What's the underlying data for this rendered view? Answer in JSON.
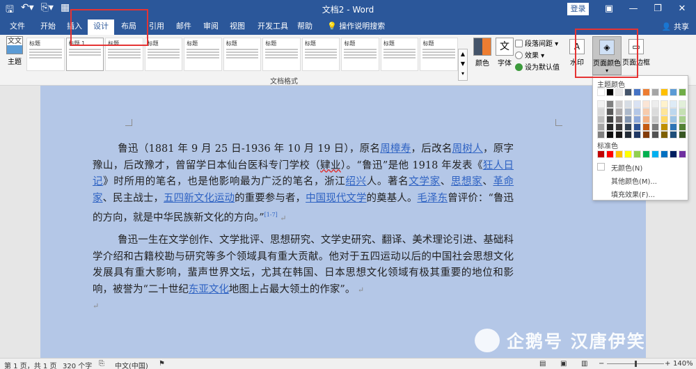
{
  "window": {
    "title": "文档2 - Word",
    "login_label": "登录",
    "share_label": "共享",
    "qat_icons": [
      "save-icon",
      "undo-icon",
      "redo-icon",
      "print-preview-icon"
    ]
  },
  "tabs": [
    {
      "label": "文件"
    },
    {
      "label": "开始"
    },
    {
      "label": "插入"
    },
    {
      "label": "设计"
    },
    {
      "label": "布局"
    },
    {
      "label": "引用"
    },
    {
      "label": "邮件"
    },
    {
      "label": "审阅"
    },
    {
      "label": "视图"
    },
    {
      "label": "开发工具"
    },
    {
      "label": "帮助"
    },
    {
      "label": "操作说明搜索"
    }
  ],
  "active_tab": "设计",
  "ribbon": {
    "theme_label": "主题",
    "theme_icon_text": "文文",
    "gallery_selected_label": "标题 1",
    "gallery_heading": "标题",
    "gallery_group_label": "文档格式",
    "colors_label": "颜色",
    "fonts_label": "字体",
    "fonts_icon_text": "文",
    "paragraph_spacing_label": "段落间距",
    "effects_label": "效果",
    "set_default_label": "设为默认值",
    "watermark_label": "水印",
    "page_color_label": "页面颜色",
    "page_border_label": "页面边框"
  },
  "document": {
    "para1": {
      "t1": "鲁迅（1881 年 9 月 25 日-1936 年 10 月 19 日），原名",
      "l1": "周樟寿",
      "t2": "，后改名",
      "l2": "周树人",
      "t3": "，原字豫山，后改豫才，曾留学日本仙台医科专门学校（",
      "u1": "肄业",
      "t4": "）。“鲁迅”是他 1918 年发表《",
      "l3": "狂人日记",
      "t5": "》时所用的笔名，也是他影响最为广泛的笔名，浙江",
      "l4": "绍兴",
      "t6": "人。著名",
      "l5": "文学家",
      "t7": "、",
      "l6": "思想家",
      "t8": "、",
      "l7": "革命家",
      "t9": "、民主战士，",
      "l8": "五四新文化运动",
      "t10": "的重要参与者，",
      "l9": "中国现代文学",
      "t11": "的奠基人。",
      "l10": "毛泽东",
      "t12": "曾评价：“鲁迅的方向，就是中华民族新文化的方向。”",
      "ref": "[1-7]"
    },
    "para2": {
      "t1": "鲁迅一生在文学创作、文学批评、思想研究、文学史研究、翻译、美术理论引进、基础科学介绍和古籍校勘与研究等多个领域具有重大贡献。他对于五四运动以后的中国社会思想文化发展具有重大影响，蜚声世界文坛，尤其在韩国、日本思想文化领域有极其重要的地位和影响，被誉为“二十世纪",
      "l1": "东亚文化",
      "t2": "地图上占最大领土的作家”。"
    },
    "page_background_color": "#b4c7e7"
  },
  "page_color_menu": {
    "theme_colors_label": "主题颜色",
    "standard_colors_label": "标准色",
    "no_color_label": "无颜色(N)",
    "more_colors_label": "其他颜色(M)...",
    "fill_effects_label": "填充效果(F)...",
    "theme_top_row": [
      "#ffffff",
      "#000000",
      "#e7e6e6",
      "#44546a",
      "#4472c4",
      "#ed7d31",
      "#a5a5a5",
      "#ffc000",
      "#5b9bd5",
      "#70ad47"
    ],
    "theme_shades": [
      [
        "#f2f2f2",
        "#808080",
        "#d0cece",
        "#d6dce4",
        "#d9e2f3",
        "#fbe5d5",
        "#ededed",
        "#fff2cc",
        "#deebf6",
        "#e2efd9"
      ],
      [
        "#d8d8d8",
        "#595959",
        "#aeabab",
        "#adb9ca",
        "#b4c7e7",
        "#f7cbac",
        "#dbdbdb",
        "#fee599",
        "#bdd7ee",
        "#c5e0b3"
      ],
      [
        "#bfbfbf",
        "#3f3f3f",
        "#757070",
        "#8496b0",
        "#8eaadb",
        "#f4b183",
        "#c9c9c9",
        "#ffd965",
        "#9cc3e5",
        "#a8d08d"
      ],
      [
        "#a5a5a5",
        "#262626",
        "#3a3838",
        "#323f4f",
        "#2f5496",
        "#c55a11",
        "#7b7b7b",
        "#bf9000",
        "#2e75b5",
        "#538135"
      ],
      [
        "#7f7f7f",
        "#0c0c0c",
        "#171616",
        "#222a35",
        "#1f3864",
        "#833c0b",
        "#525252",
        "#7f6000",
        "#1e4e79",
        "#375623"
      ]
    ],
    "standard": [
      "#c00000",
      "#ff0000",
      "#ffc000",
      "#ffff00",
      "#92d050",
      "#00b050",
      "#00b0f0",
      "#0070c0",
      "#002060",
      "#7030a0"
    ]
  },
  "watermark_overlay": {
    "text": "企鹅号 汉唐伊笑"
  },
  "status": {
    "page": "第 1 页，共 1 页",
    "words": "320 个字",
    "language": "中文(中国)",
    "zoom": "140%"
  }
}
